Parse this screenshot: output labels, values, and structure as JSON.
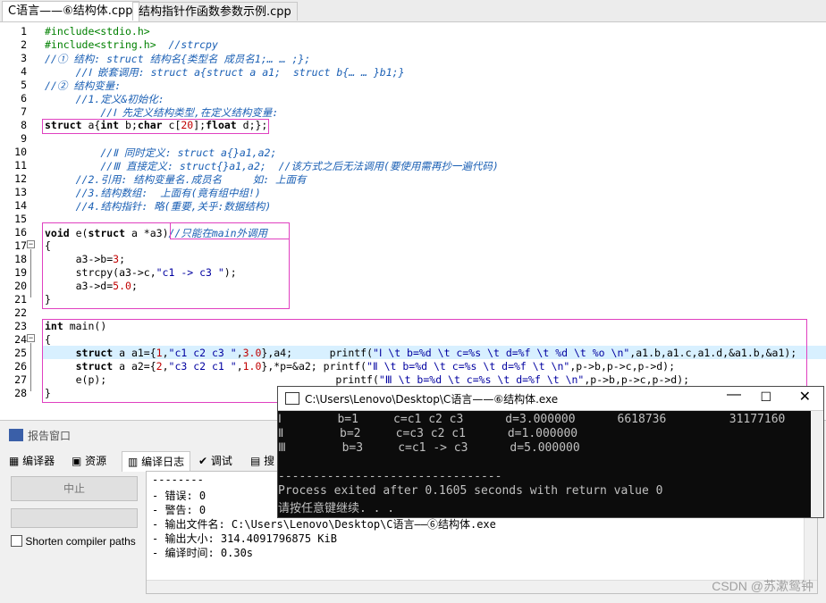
{
  "tabs": [
    "C语言——⑥结构体.cpp",
    "结构指针作函数参数示例.cpp"
  ],
  "lines": [
    {
      "n": "1",
      "t": "#include<stdio.h>"
    },
    {
      "n": "2",
      "t": "#include<string.h>  //strcpy"
    },
    {
      "n": "3",
      "t": "//① 结构: struct 结构名{类型名 成员名1;… … ;};"
    },
    {
      "n": "4",
      "t": "     //Ⅰ 嵌套调用: struct a{struct a a1;  struct b{… … }b1;}"
    },
    {
      "n": "5",
      "t": "//② 结构变量:"
    },
    {
      "n": "6",
      "t": "     //1.定义&初始化:"
    },
    {
      "n": "7",
      "t": "         //Ⅰ 先定义结构类型,在定义结构变量:"
    },
    {
      "n": "8",
      "t": "struct a{int b;char c[20];float d;};"
    },
    {
      "n": "9",
      "t": ""
    },
    {
      "n": "10",
      "t": "         //Ⅱ 同时定义: struct a{}a1,a2;"
    },
    {
      "n": "11",
      "t": "         //Ⅲ 直接定义: struct{}a1,a2;  //该方式之后无法调用(要使用需再抄一遍代码)"
    },
    {
      "n": "12",
      "t": "     //2.引用: 结构变量名.成员名     如: 上面有"
    },
    {
      "n": "13",
      "t": "     //3.结构数组:  上面有(竟有组中组!)"
    },
    {
      "n": "14",
      "t": "     //4.结构指针: 略(重要,关乎:数据结构)"
    },
    {
      "n": "15",
      "t": ""
    },
    {
      "n": "16",
      "t": "void e(struct a *a3)//只能在main外调用"
    },
    {
      "n": "17",
      "t": "{"
    },
    {
      "n": "18",
      "t": "     a3->b=3;"
    },
    {
      "n": "19",
      "t": "     strcpy(a3->c,\"c1 -> c3 \");"
    },
    {
      "n": "20",
      "t": "     a3->d=5.0;"
    },
    {
      "n": "21",
      "t": "}"
    },
    {
      "n": "22",
      "t": ""
    },
    {
      "n": "23",
      "t": "int main()"
    },
    {
      "n": "24",
      "t": "{"
    },
    {
      "n": "25",
      "t": "     struct a a1={1,\"c1 c2 c3 \",3.0},a4;      printf(\"Ⅰ \\t b=%d \\t c=%s \\t d=%f \\t %d \\t %o \\n\",a1.b,a1.c,a1.d,&a1.b,&a1);"
    },
    {
      "n": "26",
      "t": "     struct a a2={2,\"c3 c2 c1 \",1.0},*p=&a2; printf(\"Ⅱ \\t b=%d \\t c=%s \\t d=%f \\t \\n\",p->b,p->c,p->d);"
    },
    {
      "n": "27",
      "t": "     e(p);                                     printf(\"Ⅲ \\t b=%d \\t c=%s \\t d=%f \\t \\n\",p->b,p->c,p->d);"
    },
    {
      "n": "28",
      "t": "}"
    }
  ],
  "report": {
    "title": "报告窗口",
    "tabs": [
      "编译器",
      "资源",
      "编译日志",
      "调试",
      "搜"
    ],
    "stop_button": "中止",
    "shorten_label": "Shorten compiler paths",
    "log": [
      "--------",
      "- 错误: 0",
      "- 警告: 0",
      "- 输出文件名: C:\\Users\\Lenovo\\Desktop\\C语言——⑥结构体.exe",
      "- 输出大小: 314.4091796875 KiB",
      "- 编译时间: 0.30s"
    ]
  },
  "console": {
    "title": "C:\\Users\\Lenovo\\Desktop\\C语言——⑥结构体.exe",
    "lines": [
      "Ⅰ        b=1     c=c1 c2 c3      d=3.000000      6618736         31177160",
      "Ⅱ        b=2     c=c3 c2 c1      d=1.000000",
      "Ⅲ        b=3     c=c1 -> c3      d=5.000000",
      "",
      "--------------------------------",
      "Process exited after 0.1605 seconds with return value 0",
      "请按任意键继续. . ."
    ]
  },
  "watermark": "CSDN @苏漱鸳钟"
}
